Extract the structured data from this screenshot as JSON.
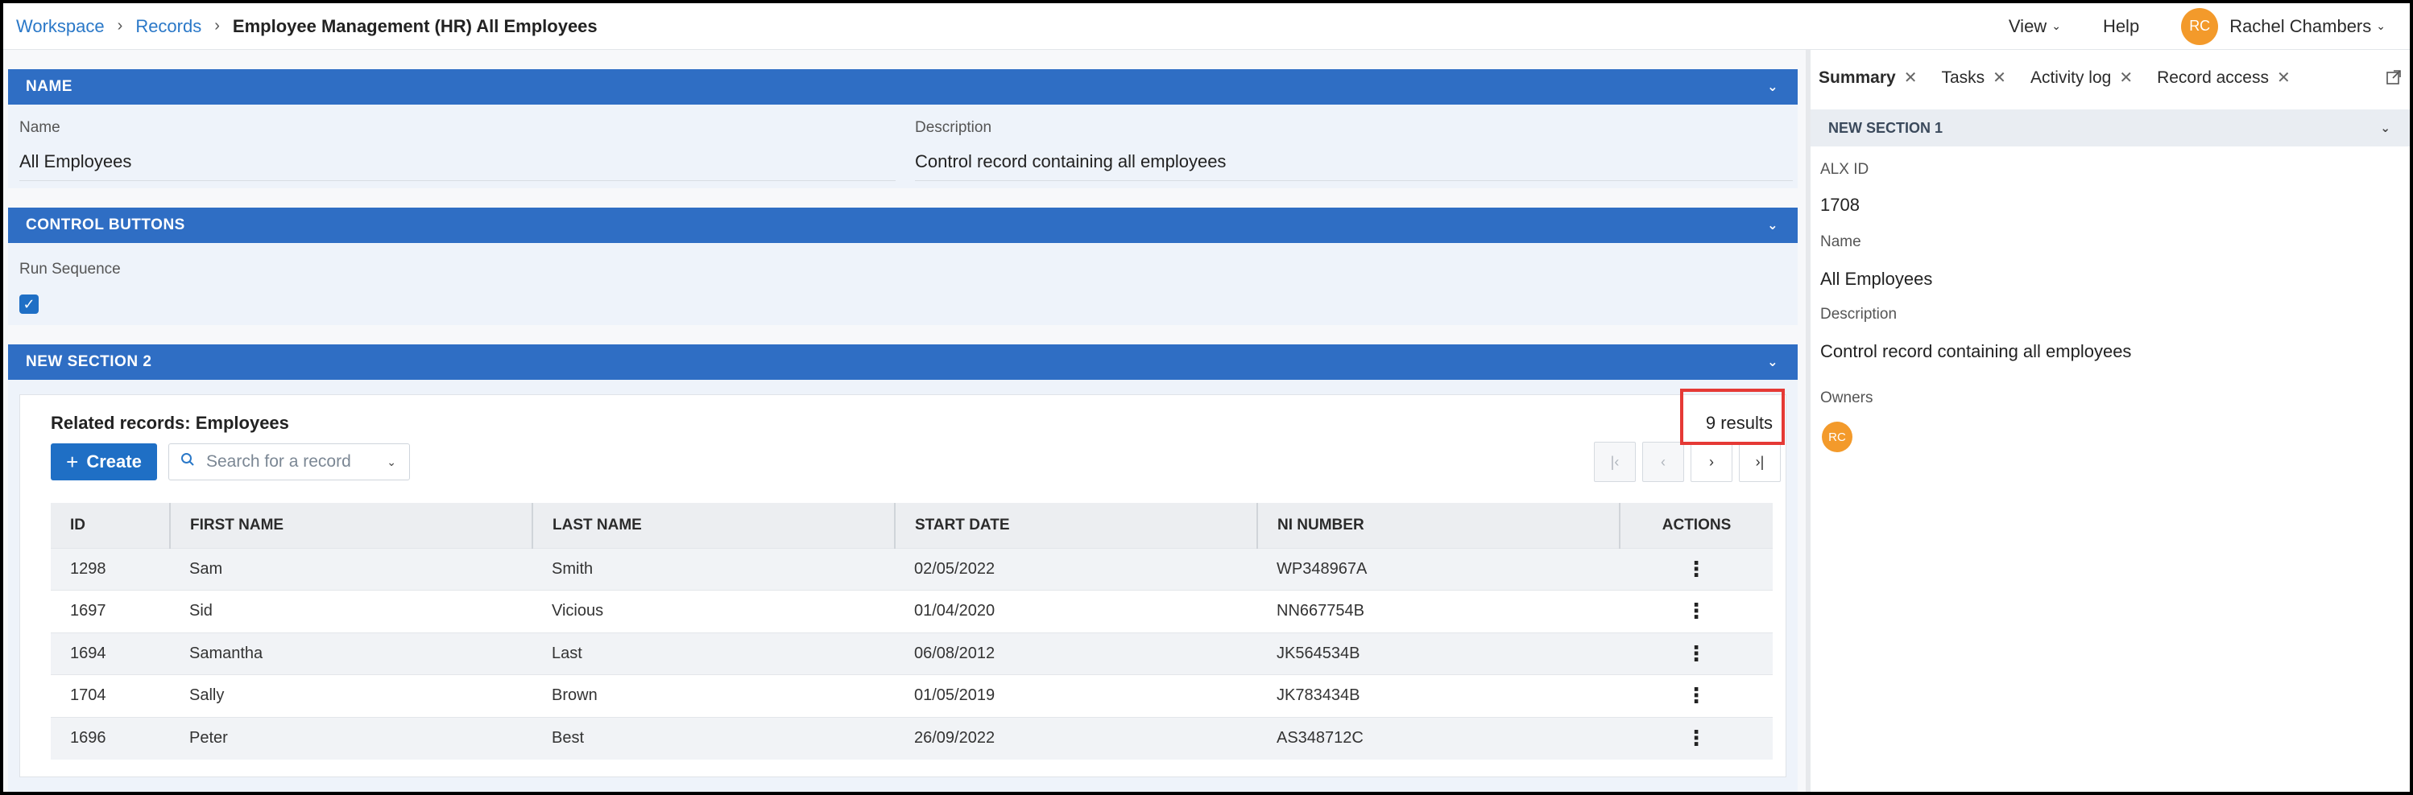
{
  "breadcrumb": {
    "items": [
      "Workspace",
      "Records"
    ],
    "current": "Employee Management (HR) All Employees"
  },
  "topnav": {
    "view": "View",
    "help": "Help",
    "user_initials": "RC",
    "user_name": "Rachel Chambers"
  },
  "sections": {
    "name": {
      "title": "NAME",
      "name_label": "Name",
      "name_value": "All Employees",
      "description_label": "Description",
      "description_value": "Control record containing all employees"
    },
    "control": {
      "title": "CONTROL BUTTONS",
      "run_sequence_label": "Run Sequence",
      "run_sequence_checked": true
    },
    "new2": {
      "title": "NEW SECTION 2"
    }
  },
  "related": {
    "title": "Related records: Employees",
    "results": "9 results",
    "create_label": "Create",
    "search_placeholder": "Search for a record",
    "columns": [
      "ID",
      "FIRST NAME",
      "LAST NAME",
      "START DATE",
      "NI NUMBER",
      "ACTIONS"
    ],
    "rows": [
      {
        "id": "1298",
        "first": "Sam",
        "last": "Smith",
        "start": "02/05/2022",
        "ni": "WP348967A"
      },
      {
        "id": "1697",
        "first": "Sid",
        "last": "Vicious",
        "start": "01/04/2020",
        "ni": "NN667754B"
      },
      {
        "id": "1694",
        "first": "Samantha",
        "last": "Last",
        "start": "06/08/2012",
        "ni": "JK564534B"
      },
      {
        "id": "1704",
        "first": "Sally",
        "last": "Brown",
        "start": "01/05/2019",
        "ni": "JK783434B"
      },
      {
        "id": "1696",
        "first": "Peter",
        "last": "Best",
        "start": "26/09/2022",
        "ni": "AS348712C"
      }
    ]
  },
  "right_panel": {
    "tabs": [
      "Summary",
      "Tasks",
      "Activity log",
      "Record access"
    ],
    "section_title": "NEW SECTION 1",
    "alx_id_label": "ALX ID",
    "alx_id_value": "1708",
    "name_label": "Name",
    "name_value": "All Employees",
    "description_label": "Description",
    "description_value": "Control record containing all employees",
    "owners_label": "Owners",
    "owner_initials": "RC"
  },
  "colors": {
    "accent": "#2f6ec4",
    "avatar": "#f39a2b",
    "highlight": "#e53935"
  }
}
